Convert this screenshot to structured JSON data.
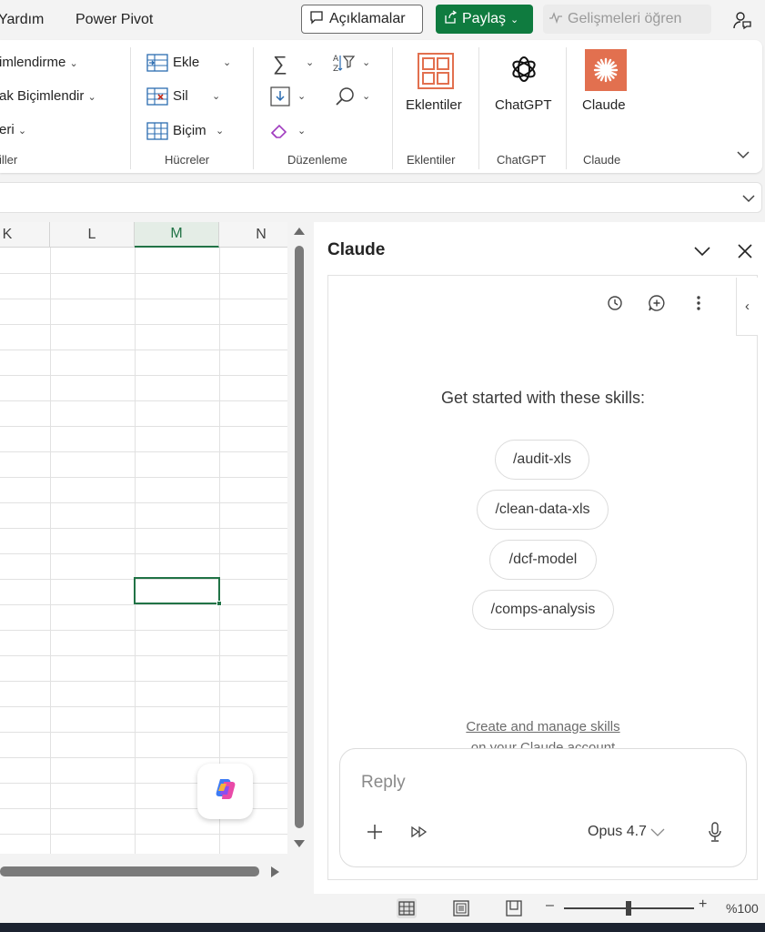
{
  "menu": {
    "tabs": [
      "Yardım",
      "Power Pivot"
    ],
    "comments_label": "Açıklamalar",
    "share_label": "Paylaş",
    "learn_label": "Gelişmeleri öğren"
  },
  "ribbon": {
    "styles": {
      "conditional_formatting": "imlendirme",
      "format_as_table": "ak Biçimlendir",
      "cell_styles": "eri",
      "group_label": "iller"
    },
    "cells": {
      "insert": "Ekle",
      "delete": "Sil",
      "format": "Biçim",
      "group_label": "Hücreler"
    },
    "editing": {
      "group_label": "Düzenleme"
    },
    "addins": {
      "button_label": "Eklentiler",
      "group_label": "Eklentiler"
    },
    "chatgpt": {
      "button_label": "ChatGPT",
      "group_label": "ChatGPT"
    },
    "claude": {
      "button_label": "Claude",
      "group_label": "Claude"
    }
  },
  "grid": {
    "columns": [
      "K",
      "L",
      "M",
      "N"
    ],
    "selected_column": "M"
  },
  "pane": {
    "title": "Claude",
    "skills_heading": "Get started with these skills:",
    "skills": [
      "/audit-xls",
      "/clean-data-xls",
      "/dcf-model",
      "/comps-analysis"
    ],
    "manage_link": "Create and manage skills",
    "manage_sub": "on your Claude account",
    "reply_placeholder": "Reply",
    "model": "Opus 4.7"
  },
  "status": {
    "zoom_level": "%100",
    "zoom_percent": 100
  },
  "colors": {
    "excel_green": "#217346",
    "share_green": "#0f7b3f",
    "claude_orange": "#e2704f"
  }
}
